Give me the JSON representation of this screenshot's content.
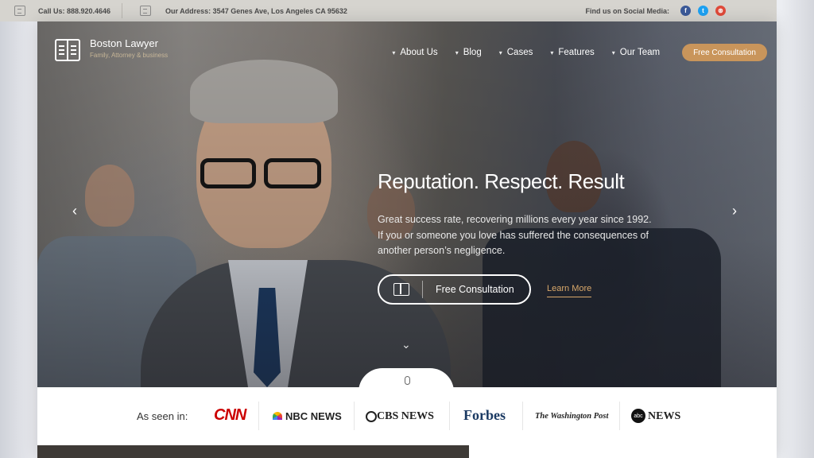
{
  "topbar": {
    "phone": "Call Us: 888.920.4646",
    "address": "Our Address: 3547 Genes Ave, Los Angeles CA 95632",
    "social_label": "Find us on Social Media:",
    "social": [
      {
        "icon": "facebook-icon",
        "glyph": "f",
        "color": "#3b5998"
      },
      {
        "icon": "twitter-icon",
        "glyph": "t",
        "color": "#1da1f2"
      },
      {
        "icon": "dribbble-icon",
        "glyph": "⊛",
        "color": "#e04a3a"
      }
    ]
  },
  "logo": {
    "title": "Boston Lawyer",
    "subtitle": "Family, Attorney & business"
  },
  "nav": {
    "items": [
      "About Us",
      "Blog",
      "Cases",
      "Features",
      "Our Team"
    ],
    "cta": "Free Consultation"
  },
  "hero": {
    "headline": "Reputation. Respect. Result",
    "subtext": "Great success rate, recovering millions every year since 1992. If you or someone you love has suffered the consequences of another person’s negligence.",
    "primary_button": "Free Consultation",
    "secondary_link": "Learn More"
  },
  "seen": {
    "label": "As seen in:",
    "brands": [
      "CNN",
      "NBC NEWS",
      "CBS NEWS",
      "Forbes",
      "The Washington Post",
      "NEWS"
    ]
  },
  "colors": {
    "accent": "#c9955b",
    "brand_cnn": "#cc0000",
    "brand_forbes": "#1b3a63"
  }
}
